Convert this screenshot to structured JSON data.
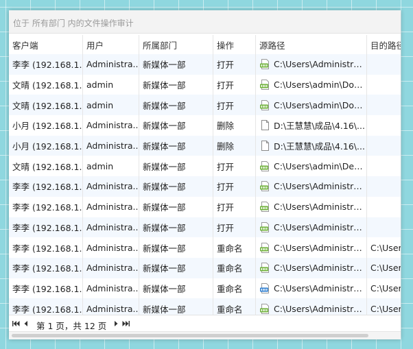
{
  "caption": "位于 所有部门 内的文件操作审计",
  "columns": [
    "客户端",
    "用户",
    "所属部门",
    "操作",
    "源路径",
    "目的路径"
  ],
  "rows": [
    {
      "client": "李李 (192.168.1...",
      "user": "Administra...",
      "dept": "新媒体一部",
      "op": "打开",
      "icon": "png-icon",
      "src": "C:\\Users\\Administrat...",
      "dst": ""
    },
    {
      "client": "文晴 (192.168.1...",
      "user": "admin",
      "dept": "新媒体一部",
      "op": "打开",
      "icon": "png-icon",
      "src": "C:\\Users\\admin\\Dow...",
      "dst": ""
    },
    {
      "client": "文晴 (192.168.1...",
      "user": "admin",
      "dept": "新媒体一部",
      "op": "打开",
      "icon": "png-icon",
      "src": "C:\\Users\\admin\\Dow...",
      "dst": ""
    },
    {
      "client": "小月 (192.168.1...",
      "user": "Administra...",
      "dept": "新媒体一部",
      "op": "删除",
      "icon": "blank-file-icon",
      "src": "D:\\王慧慧\\成品\\4.16\\...",
      "dst": ""
    },
    {
      "client": "小月 (192.168.1...",
      "user": "Administra...",
      "dept": "新媒体一部",
      "op": "删除",
      "icon": "blank-file-icon",
      "src": "D:\\王慧慧\\成品\\4.16\\...",
      "dst": ""
    },
    {
      "client": "文晴 (192.168.1...",
      "user": "admin",
      "dept": "新媒体一部",
      "op": "打开",
      "icon": "png-icon",
      "src": "C:\\Users\\admin\\Des...",
      "dst": ""
    },
    {
      "client": "李李 (192.168.1...",
      "user": "Administra...",
      "dept": "新媒体一部",
      "op": "打开",
      "icon": "png-icon",
      "src": "C:\\Users\\Administrat...",
      "dst": ""
    },
    {
      "client": "李李 (192.168.1...",
      "user": "Administra...",
      "dept": "新媒体一部",
      "op": "打开",
      "icon": "png-icon",
      "src": "C:\\Users\\Administrat...",
      "dst": ""
    },
    {
      "client": "李李 (192.168.1...",
      "user": "Administra...",
      "dept": "新媒体一部",
      "op": "打开",
      "icon": "png-icon",
      "src": "C:\\Users\\Administrat...",
      "dst": ""
    },
    {
      "client": "李李 (192.168.1...",
      "user": "Administra...",
      "dept": "新媒体一部",
      "op": "重命名",
      "icon": "png-icon",
      "src": "C:\\Users\\Administrat...",
      "dst": "C:\\User"
    },
    {
      "client": "李李 (192.168.1...",
      "user": "Administra...",
      "dept": "新媒体一部",
      "op": "重命名",
      "icon": "png-icon",
      "src": "C:\\Users\\Administrat...",
      "dst": "C:\\User"
    },
    {
      "client": "李李 (192.168.1...",
      "user": "Administra...",
      "dept": "新媒体一部",
      "op": "重命名",
      "icon": "jpg-icon",
      "src": "C:\\Users\\Administrat...",
      "dst": "C:\\User"
    },
    {
      "client": "李李 (192.168.1...",
      "user": "Administra...",
      "dept": "新媒体一部",
      "op": "重命名",
      "icon": "png-icon",
      "src": "C:\\Users\\Administrat...",
      "dst": "C:\\User"
    }
  ],
  "pager": {
    "text": "第 1 页，共 12 页",
    "icons": [
      "first-page-icon",
      "prev-page-icon",
      "next-page-icon",
      "last-page-icon"
    ]
  },
  "colors": {
    "row_alt": "#f3f8fe",
    "png_badge": "#6fb23a",
    "jpg_badge": "#2f7fd1"
  }
}
